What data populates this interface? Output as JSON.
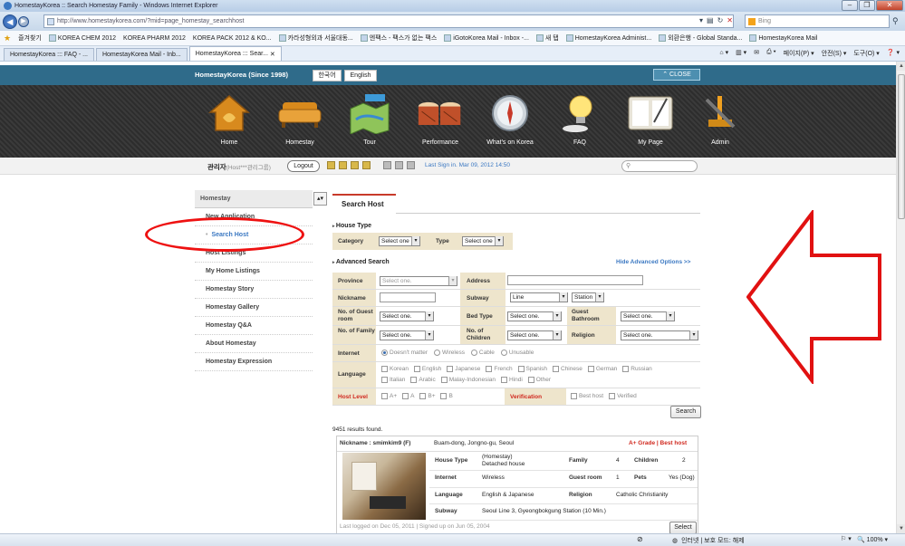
{
  "window": {
    "title": "HomestayKorea :: Search Homestay Family - Windows Internet Explorer",
    "url": "http://www.homestaykorea.com/?mid=page_homestay_searchhost",
    "search_placeholder": "Bing"
  },
  "favorites": {
    "label": "즐겨찾기",
    "items": [
      "KOREA CHEM 2012",
      "KOREA PHARM 2012",
      "KOREA PACK 2012 & KO...",
      "카라성형외과 서울대동...",
      "엔팩스 - 팩스가 없는 팩스",
      "iGotoKorea Mail - Inbox -...",
      "새 탭",
      "HomestayKorea Administ...",
      "외환은행 - Global Standa...",
      "HomestayKorea Mail"
    ]
  },
  "tabs": [
    "HomestayKorea ::: FAQ - ...",
    "HomestayKorea Mail - Inb...",
    "HomestayKorea ::: Sear..."
  ],
  "tab_tools": [
    "페이지(P) ▾",
    "안전(S) ▾",
    "도구(O) ▾",
    "❓ ▾"
  ],
  "site": {
    "brand": "HomestayKorea (Since 1998)",
    "lang_ko": "한국어",
    "lang_en": "English",
    "close": "CLOSE",
    "menu": [
      "Home",
      "Homestay",
      "Tour",
      "Performance",
      "What's on Korea",
      "FAQ",
      "My Page",
      "Admin"
    ],
    "admin_label": "관리자",
    "admin_sub": "(Host***관리그룹)",
    "logout": "Logout",
    "last_signin_label": "Last Sign in.",
    "last_signin_value": "Mar 09, 2012 14:50"
  },
  "left_nav": {
    "head": "Homestay",
    "items": [
      "New Application",
      "Search Host",
      "Host Listings",
      "My Home Listings",
      "Homestay Story",
      "Homestay Gallery",
      "Homestay Q&A",
      "About Homestay",
      "Homestay Expression"
    ]
  },
  "main": {
    "tab_title": "Search Host",
    "house_type_title": "House Type",
    "category_label": "Category",
    "category_value": "Select one",
    "type_label": "Type",
    "type_value": "Select one",
    "advanced_title": "Advanced Search",
    "hide_advanced": "Hide Advanced Options >>",
    "province_label": "Province",
    "province_value": "Select one.",
    "address_label": "Address",
    "nickname_label": "Nickname",
    "subway_label": "Subway",
    "subway_line": "Line",
    "subway_station": "Station",
    "guest_room_count_label": "No. of Guest room",
    "bed_type_label": "Bed Type",
    "guest_bathroom_label": "Guest Bathroom",
    "family_count_label": "No. of Family",
    "children_count_label": "No. of Children",
    "religion_label": "Religion",
    "select_one": "Select one.",
    "internet_label": "Internet",
    "internet_options": [
      "Doesn't matter",
      "Wireless",
      "Cable",
      "Unusable"
    ],
    "language_label": "Language",
    "languages_row1": [
      "Korean",
      "English",
      "Japanese",
      "French",
      "Spanish",
      "Chinese",
      "German",
      "Russian"
    ],
    "languages_row2": [
      "Italian",
      "Arabic",
      "Malay-Indonesian",
      "Hindi",
      "Other"
    ],
    "host_level_label": "Host Level",
    "host_levels": [
      "A+",
      "A",
      "B+",
      "B"
    ],
    "verification_label": "Verification",
    "verification_options": [
      "Best host",
      "Verified"
    ],
    "search_button": "Search",
    "results_count": "9451 results found."
  },
  "result": {
    "nickname": "Nickname : smimkim9 (F)",
    "location": "Buam-dong, Jongno-gu, Seoul",
    "grade": "A+ Grade | Best host",
    "house_type_label": "House Type",
    "house_type_value_1": "(Homestay)",
    "house_type_value_2": "Detached house",
    "family_label": "Family",
    "family_value": "4",
    "children_label": "Children",
    "children_value": "2",
    "internet_label": "Internet",
    "internet_value": "Wireless",
    "guest_room_label": "Guest room",
    "guest_room_value": "1",
    "pets_label": "Pets",
    "pets_value": "Yes (Dog)",
    "language_label": "Language",
    "language_value": "English & Japanese",
    "religion_label": "Religion",
    "religion_value": "Catholic Christianity",
    "subway_label": "Subway",
    "subway_value": "Seoul Line 3, Gyeongbokgung Station (10 Min.)",
    "logged": "Last logged on Dec 05, 2011 | Signed up on Jun 05, 2004",
    "select_button": "Select"
  },
  "status": {
    "zone": "인터넷 | 보호 모드: 해제",
    "zoom": "100%"
  },
  "colors": {
    "site_topbar": "#2f6b8a",
    "annotation_red": "#e11111",
    "tab_accent": "#c83a2a",
    "label_bg": "#eee5cc"
  }
}
